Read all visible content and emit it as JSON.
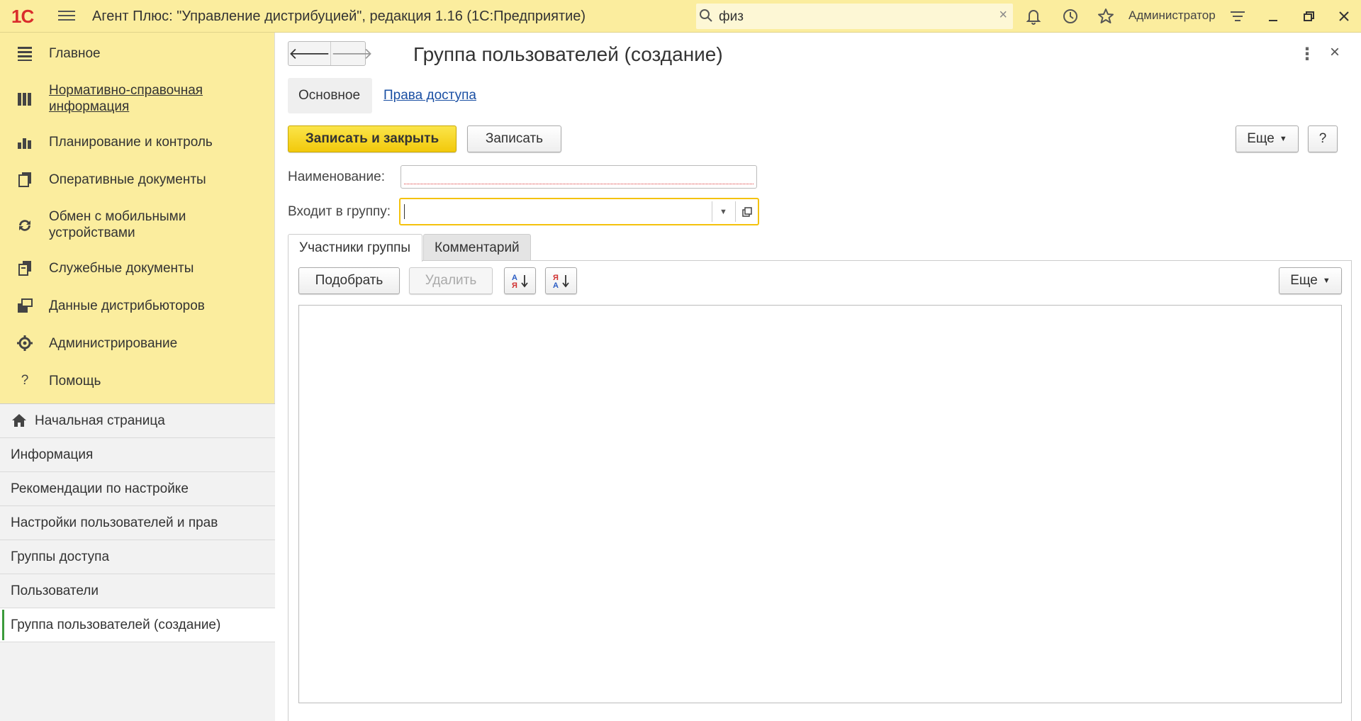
{
  "app": {
    "logo": "1С",
    "title": "Агент Плюс: \"Управление дистрибуцией\", редакция 1.16  (1С:Предприятие)",
    "search_value": "физ",
    "user": "Администратор"
  },
  "sidebar": {
    "sections": [
      {
        "label": "Главное",
        "icon": "list-icon"
      },
      {
        "label": "Нормативно-справочная информация",
        "icon": "books-icon"
      },
      {
        "label": "Планирование и контроль",
        "icon": "chart-icon"
      },
      {
        "label": "Оперативные документы",
        "icon": "documents-icon"
      },
      {
        "label": "Обмен с мобильными устройствами",
        "icon": "sync-icon"
      },
      {
        "label": "Служебные документы",
        "icon": "service-docs-icon"
      },
      {
        "label": "Данные дистрибьюторов",
        "icon": "distributor-data-icon"
      },
      {
        "label": "Администрирование",
        "icon": "gear-icon"
      },
      {
        "label": "Помощь",
        "icon": "help-icon"
      }
    ],
    "open_windows": [
      {
        "label": "Начальная страница"
      },
      {
        "label": "Информация"
      },
      {
        "label": "Рекомендации по настройке"
      },
      {
        "label": "Настройки пользователей и прав"
      },
      {
        "label": "Группы доступа"
      },
      {
        "label": "Пользователи"
      },
      {
        "label": "Группа пользователей (создание)"
      }
    ]
  },
  "form": {
    "title": "Группа пользователей (создание)",
    "tabs": {
      "main": "Основное",
      "access": "Права доступа"
    },
    "toolbar": {
      "save_close": "Записать и закрыть",
      "save": "Записать",
      "more": "Еще",
      "help": "?"
    },
    "fields": {
      "name_label": "Наименование:",
      "name_value": "",
      "group_label": "Входит в группу:",
      "group_value": ""
    },
    "inner_tabs": {
      "members": "Участники группы",
      "comment": "Комментарий"
    },
    "members_toolbar": {
      "pick": "Подобрать",
      "delete": "Удалить",
      "more": "Еще"
    }
  },
  "colors": {
    "panel_yellow": "#fbed9e",
    "primary_button": "#f2c90b",
    "link_blue": "#1a4fa3",
    "active_marker": "#3c9b3c"
  }
}
